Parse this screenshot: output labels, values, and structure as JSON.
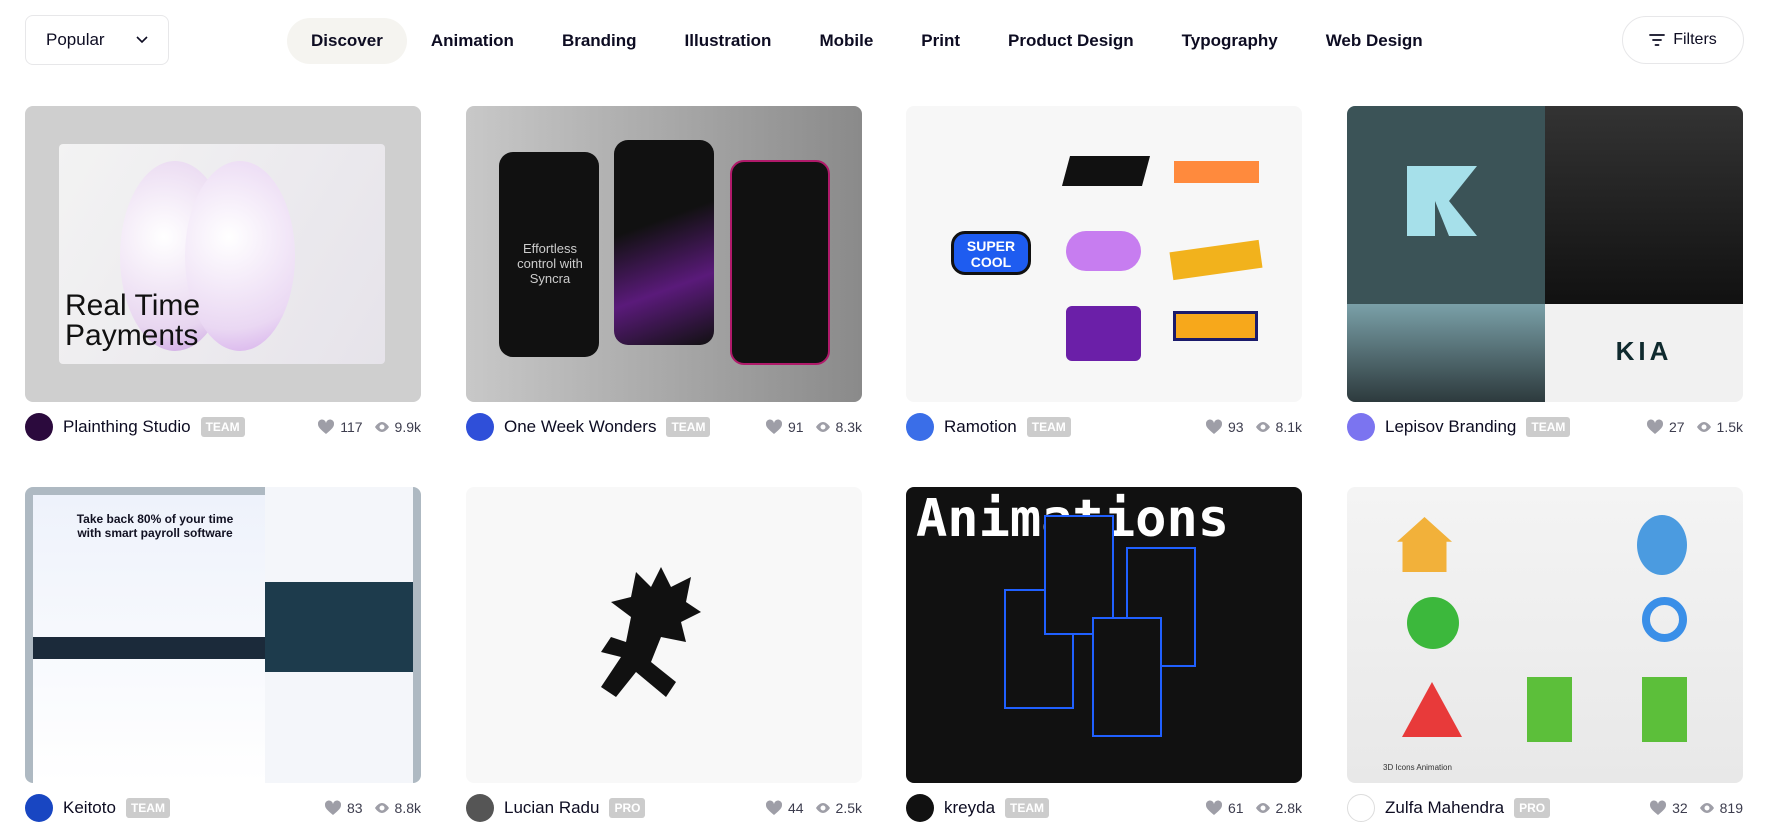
{
  "sort": {
    "label": "Popular",
    "icon": "chevron-down-icon"
  },
  "nav": [
    {
      "label": "Discover",
      "active": true
    },
    {
      "label": "Animation"
    },
    {
      "label": "Branding"
    },
    {
      "label": "Illustration"
    },
    {
      "label": "Mobile"
    },
    {
      "label": "Print"
    },
    {
      "label": "Product Design"
    },
    {
      "label": "Typography"
    },
    {
      "label": "Web Design"
    }
  ],
  "filters": {
    "label": "Filters",
    "icon": "filter-lines-icon"
  },
  "shots": [
    {
      "author": "Plainthing Studio",
      "badge": "TEAM",
      "likes": "117",
      "views": "9.9k",
      "avatar_color": "#2b0a3d",
      "image_text": "Real Time Payments"
    },
    {
      "author": "One Week Wonders",
      "badge": "TEAM",
      "likes": "91",
      "views": "8.3k",
      "avatar_color": "#2f4fd9",
      "image_text": "Effortless control with Syncra"
    },
    {
      "author": "Ramotion",
      "badge": "TEAM",
      "likes": "93",
      "views": "8.1k",
      "avatar_color": "#3a6ee8",
      "image_text": "SUPER COOL"
    },
    {
      "author": "Lepisov Branding",
      "badge": "TEAM",
      "likes": "27",
      "views": "1.5k",
      "avatar_color": "#7b74f0",
      "image_text": "KIA"
    },
    {
      "author": "Keitoto",
      "badge": "TEAM",
      "likes": "83",
      "views": "8.8k",
      "avatar_color": "#1846c2",
      "image_text": "Take back 80% of your time with smart payroll software"
    },
    {
      "author": "Lucian Radu",
      "badge": "PRO",
      "likes": "44",
      "views": "2.5k",
      "avatar_color": "#555555",
      "image_text": ""
    },
    {
      "author": "kreyda",
      "badge": "TEAM",
      "likes": "61",
      "views": "2.8k",
      "avatar_color": "#111111",
      "image_text": "Animations"
    },
    {
      "author": "Zulfa Mahendra",
      "badge": "PRO",
      "likes": "32",
      "views": "819",
      "avatar_color": "#ffffff",
      "image_text": "3D Icons Animation"
    }
  ]
}
